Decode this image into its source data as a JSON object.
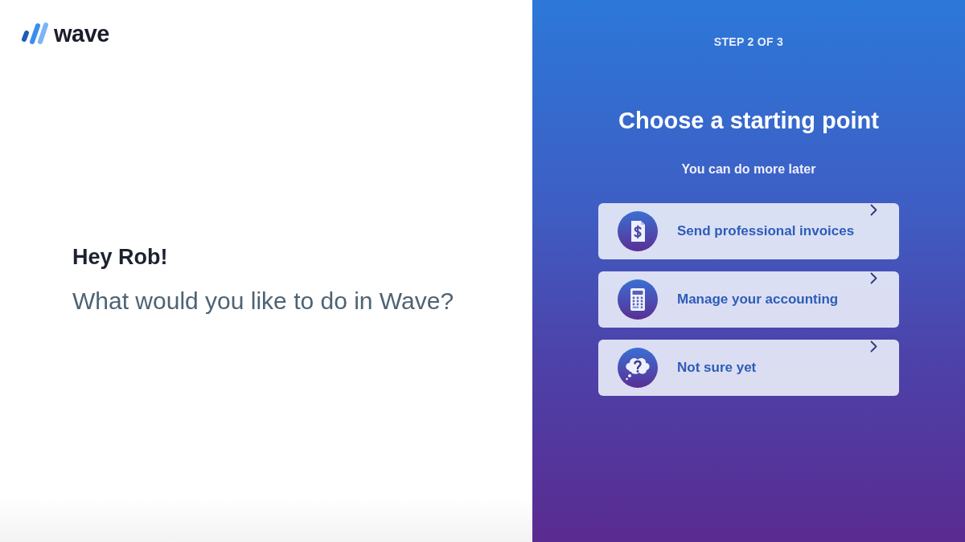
{
  "logo": {
    "wordmark": "wave"
  },
  "greeting": {
    "title": "Hey Rob!",
    "question": "What would you like to do in Wave?"
  },
  "panel": {
    "step": "STEP 2 OF 3",
    "title": "Choose a starting point",
    "subtitle": "You can do more later"
  },
  "options": [
    {
      "kind": "invoice",
      "label": "Send professional invoices"
    },
    {
      "kind": "calculator",
      "label": "Manage your accounting"
    },
    {
      "kind": "question",
      "label": "Not sure yet"
    }
  ]
}
